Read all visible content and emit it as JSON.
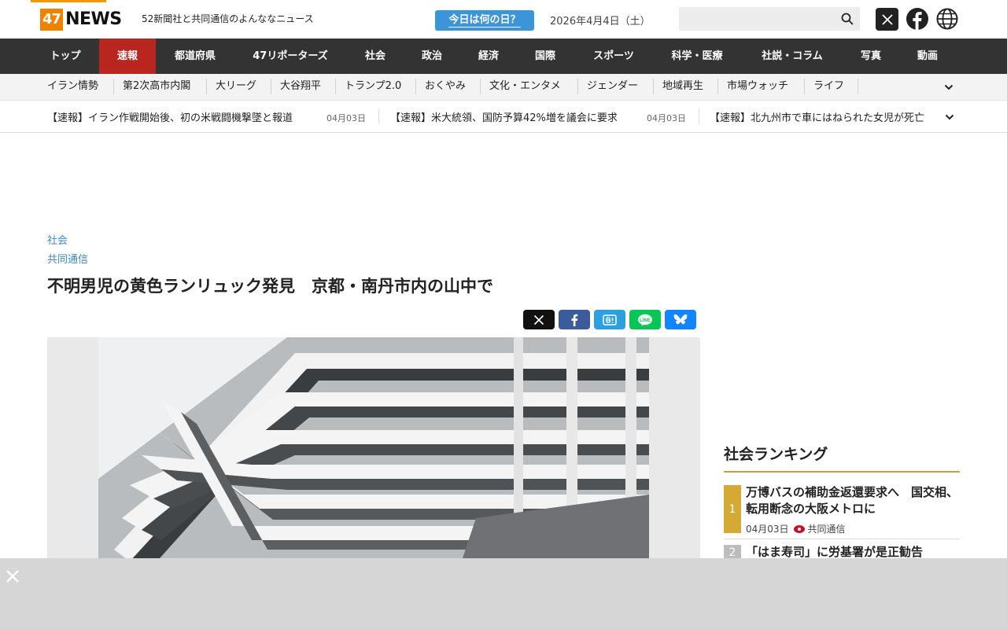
{
  "header": {
    "logo_num": "47",
    "logo_word": "NEWS",
    "tagline": "52新聞社と共同通信のよんななニュース",
    "today_button": "今日は何の日？",
    "date": "2026年4月4日（土）",
    "search_placeholder": "",
    "colors": {
      "brand": "#f08200",
      "accent": "#3b95d8"
    }
  },
  "nav": {
    "items": [
      {
        "label": "トップ"
      },
      {
        "label": "速報",
        "active": true
      },
      {
        "label": "都道府県"
      },
      {
        "label": "47リポーターズ"
      },
      {
        "label": "社会"
      },
      {
        "label": "政治"
      },
      {
        "label": "経済"
      },
      {
        "label": "国際"
      },
      {
        "label": "スポーツ"
      },
      {
        "label": "科学・医療"
      },
      {
        "label": "社説・コラム"
      },
      {
        "label": "写真"
      },
      {
        "label": "動画"
      }
    ],
    "active_color": "#b8261f"
  },
  "subnav": {
    "items": [
      "イラン情勢",
      "第2次高市内閣",
      "大リーグ",
      "大谷翔平",
      "トランプ2.0",
      "おくやみ",
      "文化・エンタメ",
      "ジェンダー",
      "地域再生",
      "市場ウォッチ",
      "ライフ"
    ]
  },
  "ticker": {
    "items": [
      {
        "title": "【速報】イラン作戦開始後、初の米戦闘機撃墜と報道",
        "date": "04月03日"
      },
      {
        "title": "【速報】米大統領、国防予算42%増を議会に要求",
        "date": "04月03日"
      },
      {
        "title": "【速報】北九州市で車にはねられた女児が死亡",
        "date": ""
      }
    ]
  },
  "article": {
    "category": "社会",
    "source": "共同通信",
    "title": "不明男児の黄色ランリュック発見　京都・南丹市内の山中で"
  },
  "share": {
    "buttons": [
      "x",
      "facebook",
      "hatena",
      "line",
      "bluesky"
    ],
    "colors": {
      "x": "#111111",
      "facebook": "#3b5b9a",
      "hatena": "#2c9fe0",
      "line": "#06c755",
      "bluesky": "#1185fe"
    }
  },
  "ranking": {
    "title": "社会ランキング",
    "items": [
      {
        "rank": "1",
        "text": "万博バスの補助金返還要求へ　国交相、転用断念の大阪メトロに",
        "date": "04月03日",
        "source": "共同通信"
      },
      {
        "rank": "2",
        "text": "「はま寿司」に労基署が是正勧告",
        "date": "",
        "source": ""
      }
    ]
  }
}
